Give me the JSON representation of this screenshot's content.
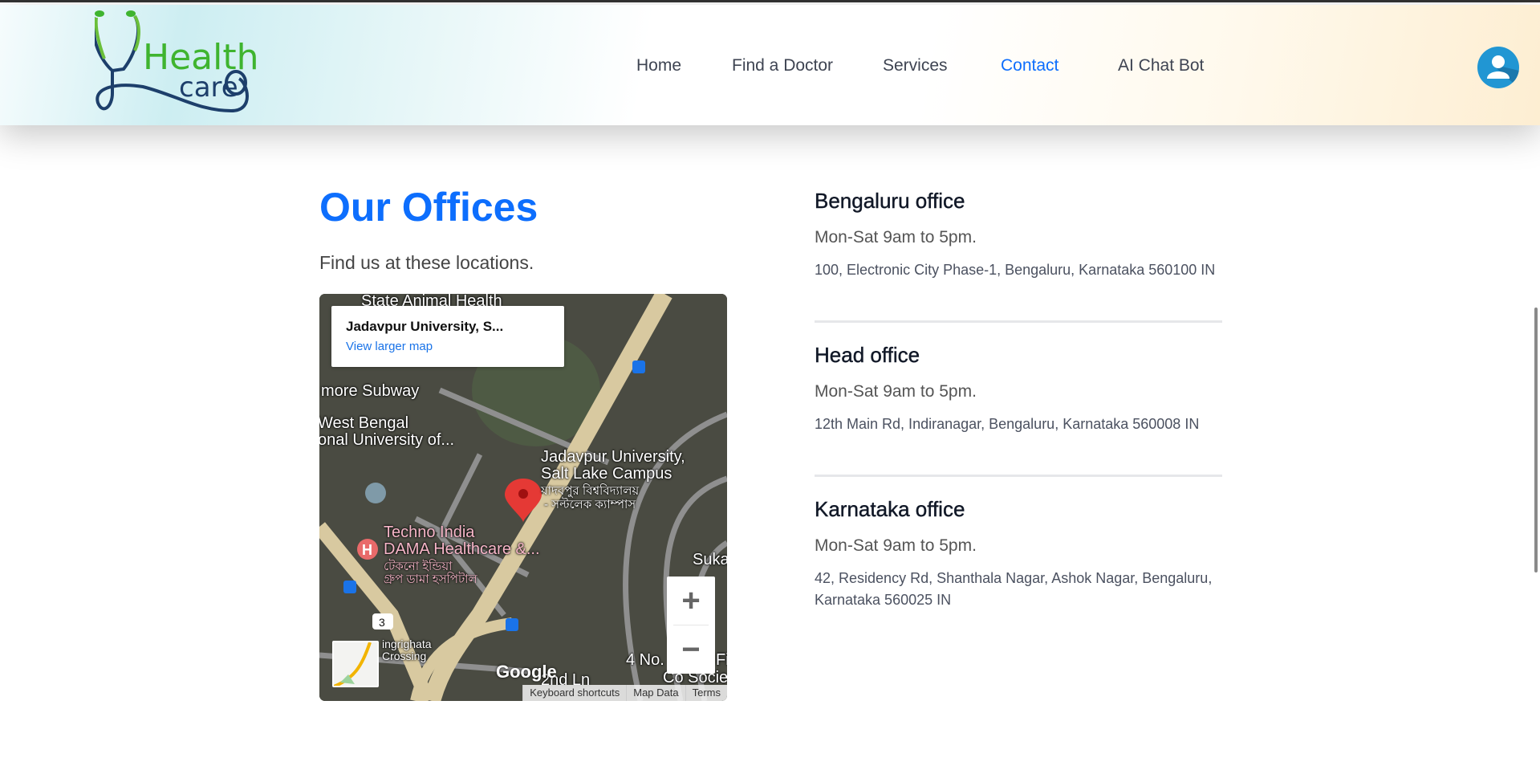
{
  "header": {
    "logo": {
      "word1": "Health",
      "word2": "care"
    },
    "nav": [
      {
        "label": "Home",
        "active": false
      },
      {
        "label": "Find a Doctor",
        "active": false
      },
      {
        "label": "Services",
        "active": false
      },
      {
        "label": "Contact",
        "active": true
      },
      {
        "label": "AI Chat Bot",
        "active": false
      }
    ],
    "avatar_icon": "user-avatar-icon",
    "accent": "#0d6efd"
  },
  "main": {
    "title": "Our Offices",
    "subtitle": "Find us at these locations.",
    "map": {
      "place_name": "Jadavpur University, S...",
      "view_larger": "View larger map",
      "labels": {
        "top": "State Animal Health",
        "subway": "more Subway",
        "wb1": "West Bengal",
        "wb2": "onal University of...",
        "ju1": "Jadavpur University,",
        "ju2": "Salt Lake Campus",
        "ju3": "যাদবপুর বিশ্ববিদ্যালয়",
        "ju4": "- সল্টলেক ক্যাম্পাস",
        "ti1": "Techno India",
        "ti2": "DAMA Healthcare &...",
        "ti3": "টেকনো ইন্ডিয়া",
        "ti4": "গ্রুপ ডামা হসপিটাল",
        "chin1": "ingrighata",
        "chin2": "Crossing",
        "suka": "Suka",
        "no4": "4 No.",
        "fi": "Fi",
        "co": "Co Socie",
        "lane": "2nd Ln",
        "route": "3"
      },
      "google": "Google",
      "zoom_in": "+",
      "zoom_out": "−",
      "attribution": [
        "Keyboard shortcuts",
        "Map Data",
        "Terms"
      ]
    },
    "offices": [
      {
        "name": "Bengaluru office",
        "hours": "Mon-Sat 9am to 5pm.",
        "address": "100, Electronic City Phase-1, Bengaluru, Karnataka 560100 IN"
      },
      {
        "name": "Head office",
        "hours": "Mon-Sat 9am to 5pm.",
        "address": "12th Main Rd, Indiranagar, Bengaluru, Karnataka 560008 IN"
      },
      {
        "name": "Karnataka office",
        "hours": "Mon-Sat 9am to 5pm.",
        "address": "42, Residency Rd, Shanthala Nagar, Ashok Nagar, Bengaluru, Karnataka 560025 IN"
      }
    ]
  }
}
